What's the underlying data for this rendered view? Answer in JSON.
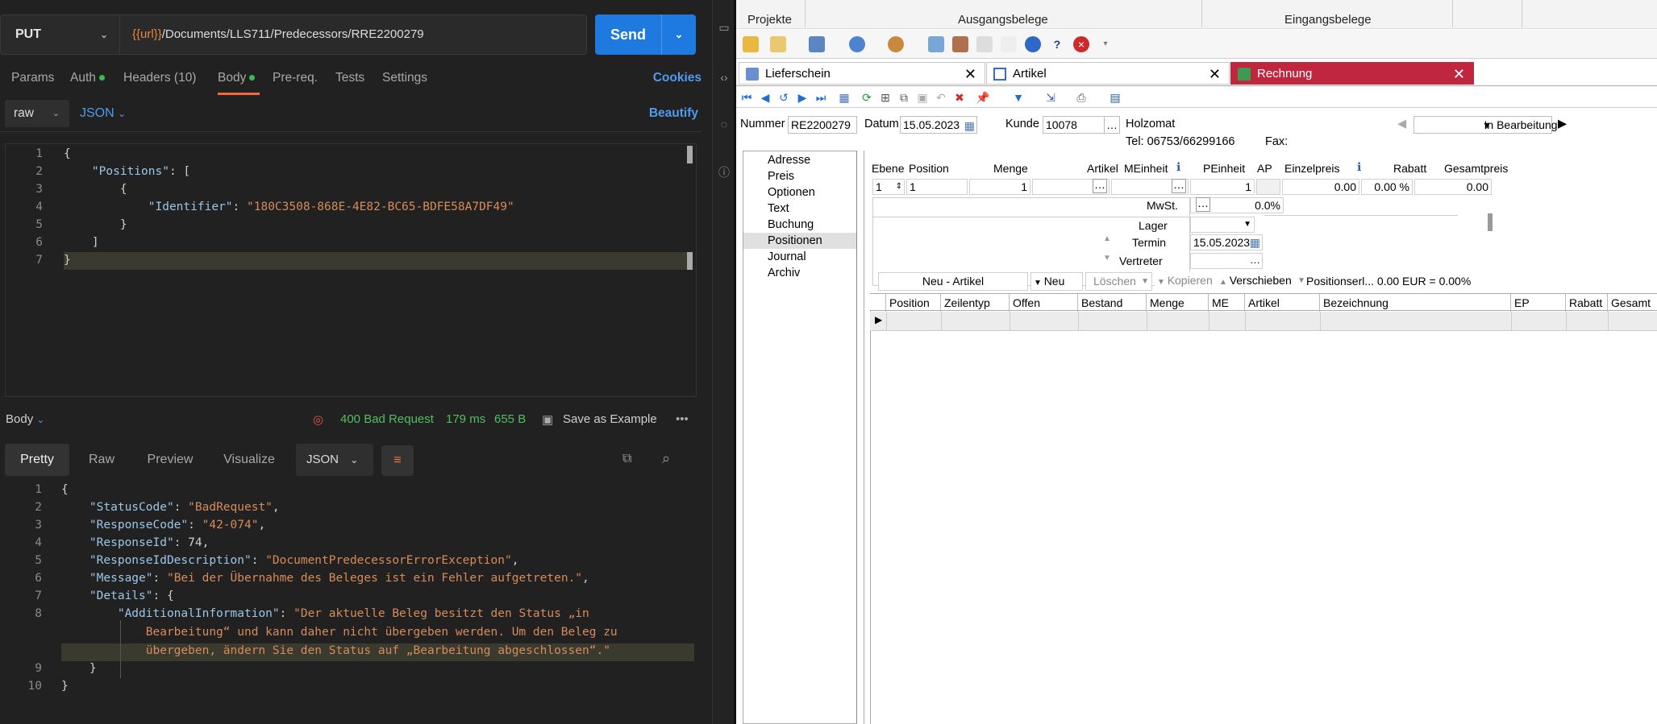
{
  "request": {
    "method": "PUT",
    "url_var": "{{url}}",
    "url_path": "/Documents/LLS711/Predecessors/RRE2200279",
    "send_label": "Send",
    "tabs": {
      "params": "Params",
      "auth": "Auth",
      "headers": "Headers",
      "headers_count": "(10)",
      "body": "Body",
      "prereq": "Pre-req.",
      "tests": "Tests",
      "settings": "Settings",
      "cookies": "Cookies"
    },
    "body_mode": "raw",
    "body_lang": "JSON",
    "beautify": "Beautify",
    "lines": [
      "1",
      "2",
      "3",
      "4",
      "5",
      "6",
      "7"
    ]
  },
  "response": {
    "body_label": "Body",
    "status": "400 Bad Request",
    "time": "179 ms",
    "size": "655 B",
    "save_example": "Save as Example",
    "tabs": {
      "pretty": "Pretty",
      "raw": "Raw",
      "preview": "Preview",
      "visualize": "Visualize",
      "lang": "JSON"
    },
    "lines": [
      "1",
      "2",
      "3",
      "4",
      "5",
      "6",
      "7",
      "8",
      "9",
      "10"
    ]
  },
  "erp": {
    "ribbon": {
      "projekte": "Projekte",
      "ausgangsbelege": "Ausgangsbelege",
      "eingangsbelege": "Eingangsbelege"
    },
    "tabs": {
      "lieferschein": "Lieferschein",
      "artikel": "Artikel",
      "rechnung": "Rechnung"
    },
    "header": {
      "nummer_label": "Nummer",
      "nummer": "RE2200279",
      "datum_label": "Datum",
      "datum": "15.05.2023",
      "kunde_label": "Kunde",
      "kunde": "10078",
      "kunde_name": "Holzomat",
      "tel": "Tel: 06753/66299166",
      "fax": "Fax:",
      "status": "In Bearbeitung"
    },
    "sidenav": [
      "Adresse",
      "Preis",
      "Optionen",
      "Text",
      "Buchung",
      "Positionen",
      "Journal",
      "Archiv"
    ],
    "pos_cols": {
      "ebene": "Ebene",
      "position": "Position",
      "menge": "Menge",
      "artikel": "Artikel",
      "meinheit": "MEinheit",
      "peinheit": "PEinheit",
      "ap": "AP",
      "einzelpreis": "Einzelpreis",
      "rabatt": "Rabatt",
      "gesamtpreis": "Gesamtpreis"
    },
    "pos_row": {
      "ebene": "1",
      "position": "1",
      "menge": "1",
      "peinheit": "1",
      "einzelpreis": "0.00",
      "rabatt": "0.00 %",
      "gesamtpreis": "0.00"
    },
    "mwst_label": "MwSt.",
    "mwst": "0.0%",
    "lager_label": "Lager",
    "termin_label": "Termin",
    "termin": "15.05.2023",
    "vertreter_label": "Vertreter",
    "buttons": {
      "neu_artikel": "Neu - Artikel",
      "neu": "Neu",
      "loeschen": "Löschen",
      "kopieren": "Kopieren",
      "verschieben": "Verschieben",
      "summary": "Positionserl... 0.00 EUR = 0.00%"
    },
    "grid_cols": [
      "Position",
      "Zeilentyp",
      "Offen",
      "Bestand",
      "Menge",
      "ME",
      "Artikel",
      "Bezeichnung",
      "EP",
      "Rabatt",
      "Gesamt"
    ]
  }
}
